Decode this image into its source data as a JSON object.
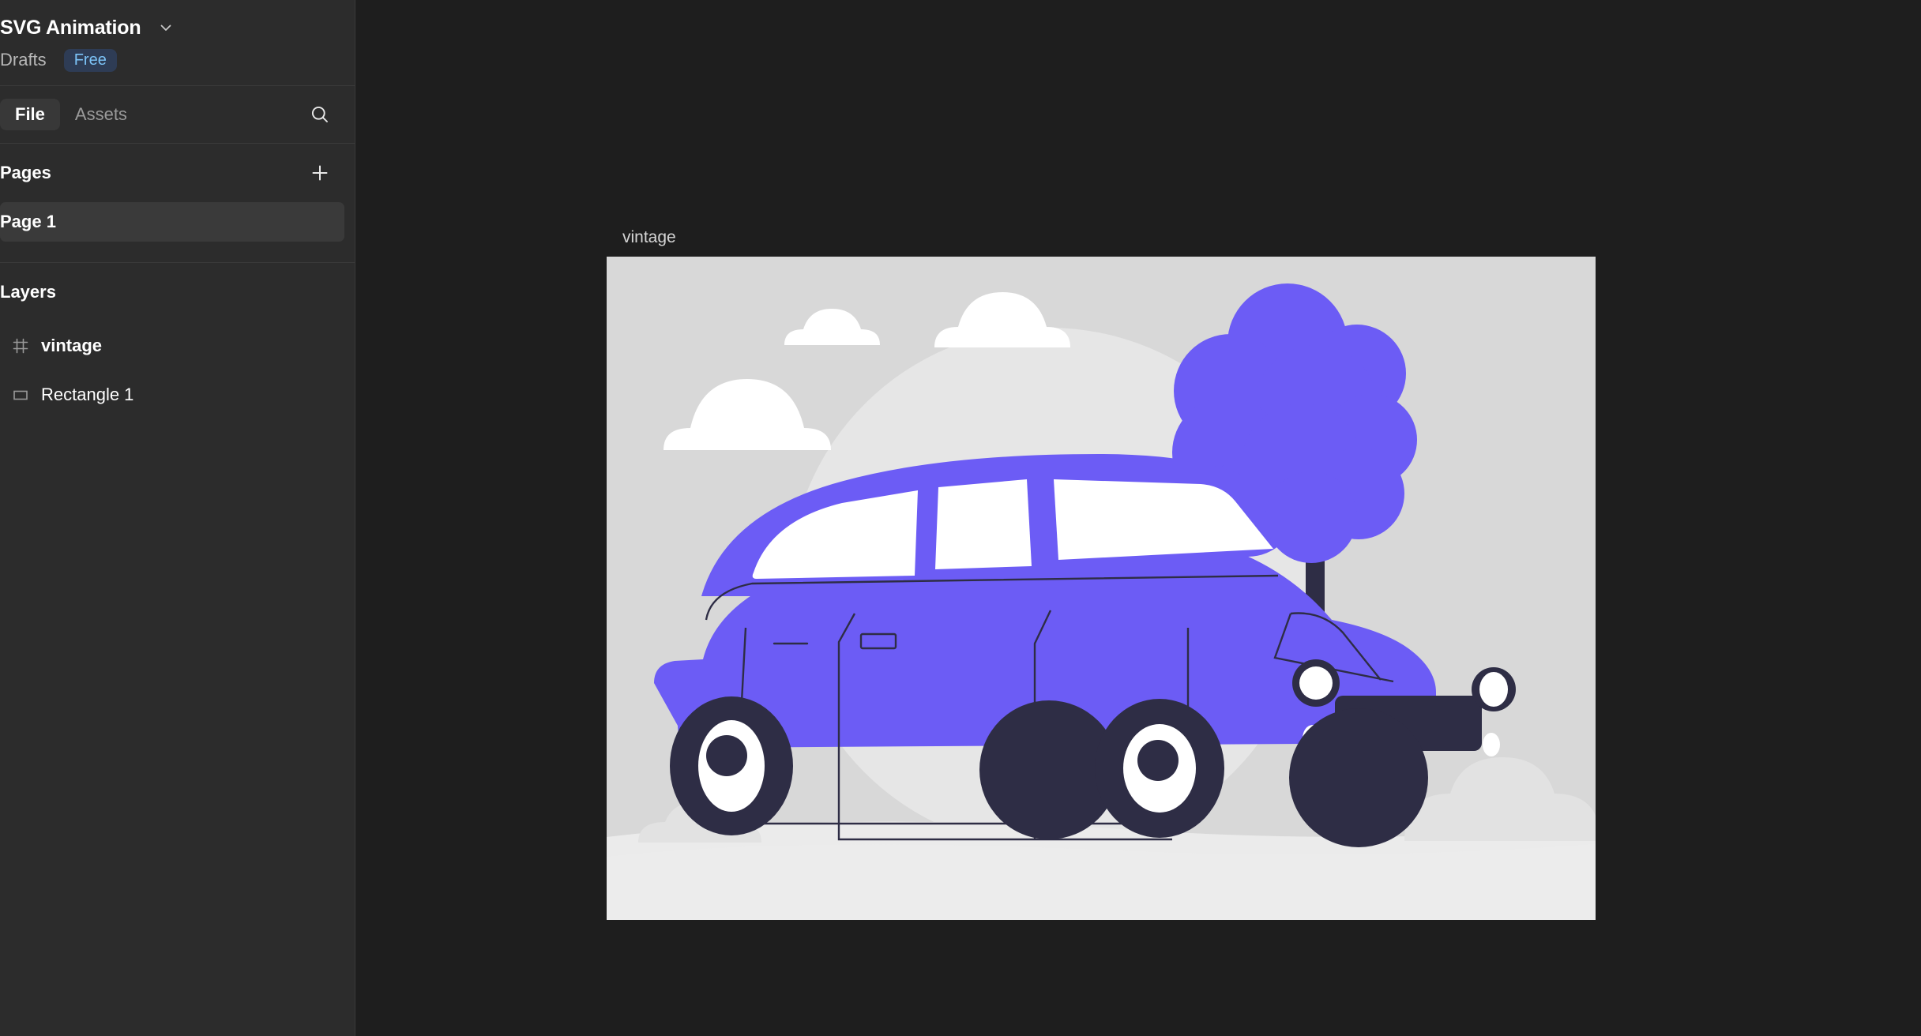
{
  "app": {
    "file_title": "SVG Animation",
    "project": "Drafts",
    "plan_badge": "Free",
    "chevron_icon": "chevron-down-icon"
  },
  "tabs": {
    "items": [
      {
        "label": "File",
        "active": true
      },
      {
        "label": "Assets",
        "active": false
      }
    ],
    "search_icon": "search-icon"
  },
  "pages": {
    "title": "Pages",
    "add_icon": "plus-icon",
    "items": [
      {
        "label": "Page 1",
        "selected": true
      }
    ]
  },
  "layers": {
    "title": "Layers",
    "items": [
      {
        "label": "vintage",
        "icon": "frame-icon",
        "bold": true
      },
      {
        "label": "Rectangle 1",
        "icon": "rectangle-icon",
        "bold": false
      }
    ]
  },
  "canvas": {
    "frame_label": "vintage",
    "frame_background": "#d8d8d8",
    "artwork_name": "vintage-car-illustration",
    "colors": {
      "workspace_background": "#1e1e1e",
      "sidebar_background": "#2c2c2c",
      "frame_fill": "#d8d8d8",
      "hill_light": "#e6e6e6",
      "ground": "#ebebeb",
      "sun": "#fa5c55",
      "cloud_white": "#ffffff",
      "cloud_gray": "#e4e4e4",
      "purple": "#6c5cf5",
      "purple_dark": "#5b4ae8",
      "navy": "#2e2d45",
      "window_white": "#ffffff",
      "outline": "#2e2d45"
    }
  }
}
